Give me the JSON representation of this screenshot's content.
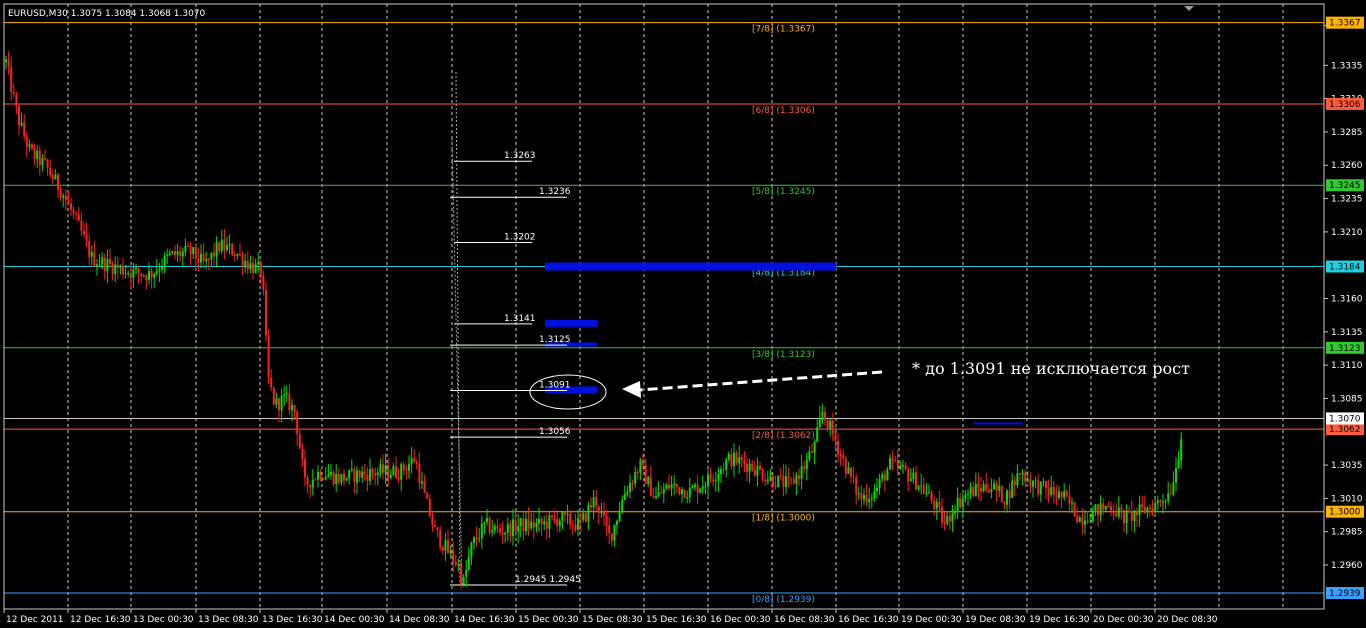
{
  "header": {
    "symbol_label": "EURUSD,M30  1.3075 1.3084 1.3068 1.3070"
  },
  "annotation": {
    "text": "* до 1.3091 не исключается рост"
  },
  "colors": {
    "bull": "#00e000",
    "bear": "#ff2020",
    "grid": "#c8c8c8",
    "murrey_7_8": "#ffb400",
    "murrey_6_8": "#ff5a3c",
    "murrey_5_8": "#32c832",
    "murrey_4_8": "#20d0e0",
    "murrey_3_8": "#32c832",
    "murrey_2_8": "#ff5a3c",
    "murrey_1_8": "#ffb400",
    "murrey_0_8": "#3ca0ff",
    "zone": "#0010e0"
  },
  "chart_data": {
    "type": "candlestick",
    "title": "EURUSD,M30",
    "ohlc_header": {
      "open": 1.3075,
      "high": 1.3084,
      "low": 1.3068,
      "close": 1.307
    },
    "y_range": [
      1.2927,
      1.3381
    ],
    "x_tick_labels": [
      "12 Dec 2011",
      "12 Dec 16:30",
      "13 Dec 00:30",
      "13 Dec 08:30",
      "13 Dec 16:30",
      "14 Dec 00:30",
      "14 Dec 08:30",
      "14 Dec 16:30",
      "15 Dec 00:30",
      "15 Dec 08:30",
      "15 Dec 16:30",
      "16 Dec 00:30",
      "16 Dec 08:30",
      "16 Dec 16:30",
      "19 Dec 00:30",
      "19 Dec 08:30",
      "19 Dec 16:30",
      "20 Dec 00:30",
      "20 Dec 08:30"
    ],
    "y_tick_labels": [
      "1.3365",
      "1.3335",
      "1.3310",
      "1.3285",
      "1.3260",
      "1.3235",
      "1.3210",
      "1.3160",
      "1.3135",
      "1.3110",
      "1.3085",
      "1.3035",
      "1.3010",
      "1.2985",
      "1.2960"
    ],
    "murrey_levels": [
      {
        "label": "[7/8]  (1.3367)",
        "price": 1.3367,
        "tag": "1.3367"
      },
      {
        "label": "[6/8]  (1.3306)",
        "price": 1.3306,
        "tag": "1.3306"
      },
      {
        "label": "[5/8]  (1.3245)",
        "price": 1.3245,
        "tag": "1.3245"
      },
      {
        "label": "[4/8]  (1.3184)",
        "price": 1.3184,
        "tag": "1.3184"
      },
      {
        "label": "[3/8]  (1.3123)",
        "price": 1.3123,
        "tag": "1.3123"
      },
      {
        "label": "[2/8]  (1.3062)",
        "price": 1.3062,
        "tag": "1.3062"
      },
      {
        "label": "[1/8]  (1.3000)",
        "price": 1.3,
        "tag": "1.3000"
      },
      {
        "label": "[0/8]  (1.2939)",
        "price": 1.2939,
        "tag": "1.2939"
      }
    ],
    "current_price_tag": "1.3070",
    "fib_levels": [
      {
        "label": "1.3263",
        "price": 1.3263
      },
      {
        "label": "1.3236",
        "price": 1.3236
      },
      {
        "label": "1.3202",
        "price": 1.3202
      },
      {
        "label": "1.3141",
        "price": 1.3141
      },
      {
        "label": "1.3125",
        "price": 1.3125
      },
      {
        "label": "1.3091",
        "price": 1.3091
      },
      {
        "label": "1.3056",
        "price": 1.3056
      },
      {
        "label": "1.2945  1.2945",
        "price": 1.2945
      }
    ],
    "price_path": [
      [
        0,
        1.336
      ],
      [
        8,
        1.333
      ],
      [
        18,
        1.3295
      ],
      [
        30,
        1.327
      ],
      [
        45,
        1.326
      ],
      [
        62,
        1.324
      ],
      [
        78,
        1.3215
      ],
      [
        92,
        1.319
      ],
      [
        110,
        1.3185
      ],
      [
        130,
        1.318
      ],
      [
        150,
        1.3178
      ],
      [
        170,
        1.3192
      ],
      [
        190,
        1.3195
      ],
      [
        205,
        1.3185
      ],
      [
        220,
        1.32
      ],
      [
        235,
        1.3195
      ],
      [
        250,
        1.3185
      ],
      [
        262,
        1.318
      ],
      [
        268,
        1.31
      ],
      [
        275,
        1.308
      ],
      [
        285,
        1.3085
      ],
      [
        295,
        1.3075
      ],
      [
        305,
        1.302
      ],
      [
        320,
        1.303
      ],
      [
        340,
        1.3025
      ],
      [
        360,
        1.3028
      ],
      [
        380,
        1.303
      ],
      [
        400,
        1.303
      ],
      [
        415,
        1.304
      ],
      [
        425,
        1.301
      ],
      [
        435,
        1.2985
      ],
      [
        448,
        1.297
      ],
      [
        458,
        1.296
      ],
      [
        463,
        1.2945
      ],
      [
        472,
        1.2975
      ],
      [
        485,
        1.299
      ],
      [
        500,
        1.2985
      ],
      [
        520,
        1.299
      ],
      [
        540,
        1.299
      ],
      [
        560,
        1.2995
      ],
      [
        580,
        1.299
      ],
      [
        595,
        1.301
      ],
      [
        610,
        1.298
      ],
      [
        625,
        1.3015
      ],
      [
        640,
        1.3035
      ],
      [
        655,
        1.301
      ],
      [
        670,
        1.302
      ],
      [
        690,
        1.3015
      ],
      [
        710,
        1.3025
      ],
      [
        730,
        1.304
      ],
      [
        750,
        1.3035
      ],
      [
        770,
        1.3025
      ],
      [
        790,
        1.302
      ],
      [
        805,
        1.3035
      ],
      [
        815,
        1.305
      ],
      [
        822,
        1.3075
      ],
      [
        832,
        1.306
      ],
      [
        845,
        1.3035
      ],
      [
        860,
        1.301
      ],
      [
        875,
        1.3015
      ],
      [
        890,
        1.3035
      ],
      [
        905,
        1.303
      ],
      [
        920,
        1.302
      ],
      [
        935,
        1.3005
      ],
      [
        945,
        1.299
      ],
      [
        955,
        1.3005
      ],
      [
        970,
        1.3015
      ],
      [
        990,
        1.302
      ],
      [
        1005,
        1.301
      ],
      [
        1020,
        1.303
      ],
      [
        1035,
        1.302
      ],
      [
        1050,
        1.3015
      ],
      [
        1065,
        1.301
      ],
      [
        1080,
        1.2995
      ],
      [
        1095,
        1.3
      ],
      [
        1110,
        1.3005
      ],
      [
        1125,
        1.2995
      ],
      [
        1140,
        1.3
      ],
      [
        1155,
        1.3005
      ],
      [
        1170,
        1.3015
      ],
      [
        1178,
        1.304
      ],
      [
        1183,
        1.307
      ]
    ]
  }
}
